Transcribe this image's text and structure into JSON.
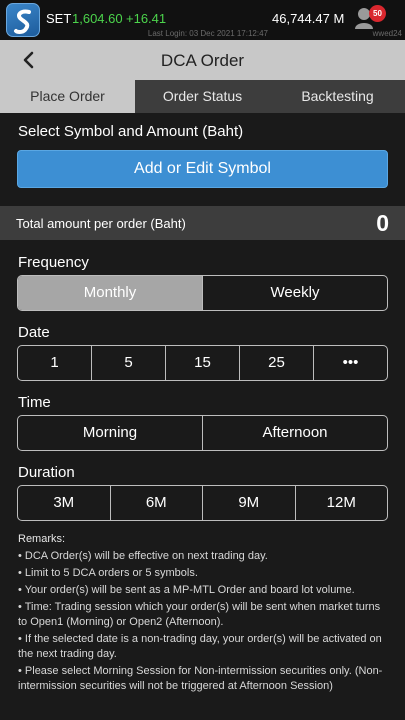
{
  "status": {
    "index_name": "SET",
    "index_value": "1,604.60",
    "index_change": "+16.41",
    "last_login": "Last Login: 03 Dec 2021 17:12:47",
    "balance": "46,744.47 M",
    "notification_count": "50",
    "user_id": "wwed24",
    "colors": {
      "up": "#4cd44c",
      "badge": "#d9272e"
    }
  },
  "header": {
    "title": "DCA Order"
  },
  "tabs": [
    {
      "label": "Place Order",
      "active": true
    },
    {
      "label": "Order Status",
      "active": false
    },
    {
      "label": "Backtesting",
      "active": false
    }
  ],
  "symbol_section": {
    "title": "Select Symbol and Amount (Baht)",
    "add_button": "Add or Edit Symbol"
  },
  "total": {
    "label": "Total amount per order (Baht)",
    "value": "0"
  },
  "frequency": {
    "title": "Frequency",
    "options": [
      "Monthly",
      "Weekly"
    ],
    "selected": "Monthly"
  },
  "date": {
    "title": "Date",
    "options": [
      "1",
      "5",
      "15",
      "25",
      "•••"
    ]
  },
  "time": {
    "title": "Time",
    "options": [
      "Morning",
      "Afternoon"
    ]
  },
  "duration": {
    "title": "Duration",
    "options": [
      "3M",
      "6M",
      "9M",
      "12M"
    ]
  },
  "remarks": {
    "title": "Remarks:",
    "items": [
      "• DCA Order(s) will be effective on next trading day.",
      "• Limit to 5 DCA orders or 5 symbols.",
      "• Your order(s) will be sent as a MP-MTL Order and board lot volume.",
      "• Time: Trading session which your order(s) will be sent when market turns to Open1 (Morning) or Open2 (Afternoon).",
      "• If the selected date is a non-trading day, your order(s) will be activated on the next trading day.",
      "• Please select Morning Session for Non-intermission securities only. (Non-intermission securities will not be triggered at Afternoon Session)"
    ]
  },
  "icons": {
    "logo": "app-logo-icon",
    "back": "chevron-left-icon",
    "avatar": "user-avatar-icon"
  }
}
